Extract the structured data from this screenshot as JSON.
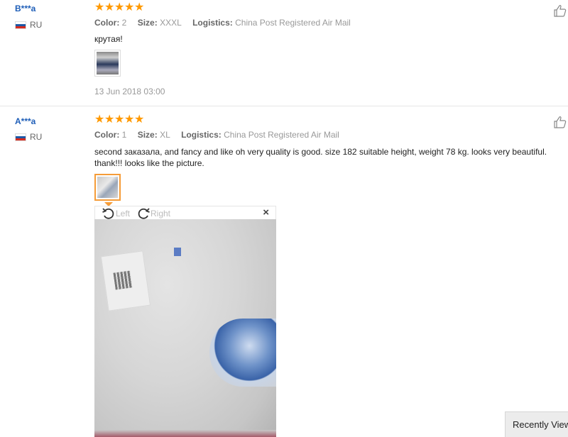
{
  "reviews": [
    {
      "user": "B***a",
      "country": "RU",
      "rating": 5,
      "attributes": {
        "color_label": "Color:",
        "color_value": "2",
        "size_label": "Size:",
        "size_value": "XXXL",
        "logistics_label": "Logistics:",
        "logistics_value": "China Post Registered Air Mail"
      },
      "text": "крутая!",
      "date": "13 Jun 2018 03:00"
    },
    {
      "user": "A***a",
      "country": "RU",
      "rating": 5,
      "attributes": {
        "color_label": "Color:",
        "color_value": "1",
        "size_label": "Size:",
        "size_value": "XL",
        "logistics_label": "Logistics:",
        "logistics_value": "China Post Registered Air Mail"
      },
      "text_line1": "second заказала, and fancy and like oh very quality is good. size 182 suitable height, weight 78 kg. looks very beautiful.",
      "text_line2": "thank!!! looks like the picture."
    }
  ],
  "viewer": {
    "rotate_left": "Left",
    "rotate_right": "Right",
    "close": "×"
  },
  "recently_viewed": "Recently Viewed",
  "icons": {
    "star": "star-icon",
    "like": "thumbs-up-icon",
    "flag": "russia-flag-icon",
    "rotate_left": "rotate-left-icon",
    "rotate_right": "rotate-right-icon",
    "close": "close-icon"
  },
  "colors": {
    "username": "#1e5eb8",
    "star": "#ff9900",
    "selected_thumb": "#f59c38"
  }
}
